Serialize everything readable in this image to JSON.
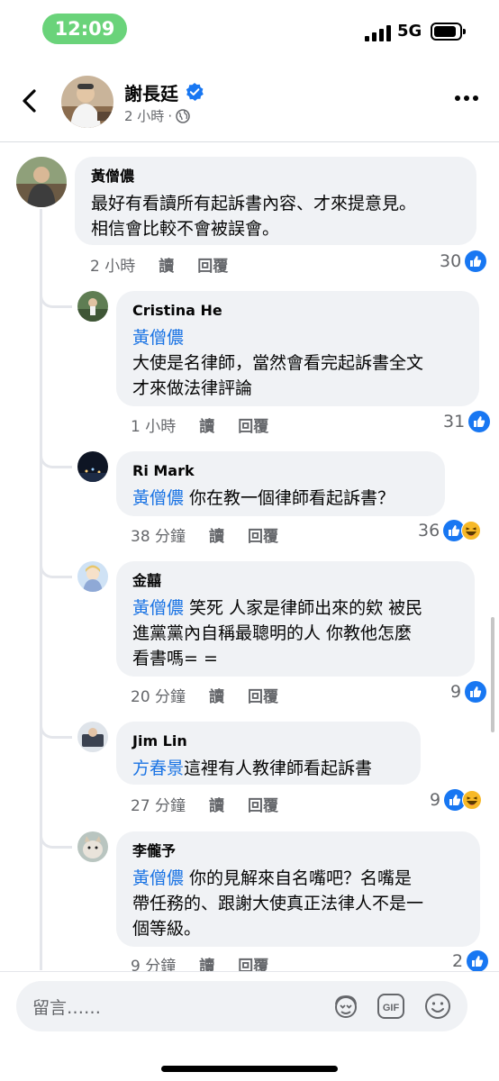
{
  "status_bar": {
    "time": "12:09",
    "network": "5G"
  },
  "header": {
    "page_name": "謝長廷",
    "post_time": "2 小時",
    "separator": "·"
  },
  "comments": [
    {
      "author": "黃僧儂",
      "mention": "",
      "text": "最好有看讀所有起訴書內容、才來提意見。\n相信會比較不會被誤會。",
      "time": "2 小時",
      "read_label": "讀",
      "reply_label": "回覆",
      "reaction_count": "30",
      "reactions": [
        "like-icon"
      ]
    },
    {
      "author": "Cristina He",
      "mention": "黃僧儂",
      "text": "大使是名律師，當然會看完起訴書全文\n才來做法律評論",
      "time": "1 小時",
      "read_label": "讀",
      "reply_label": "回覆",
      "reaction_count": "31",
      "reactions": [
        "like-icon"
      ]
    },
    {
      "author": "Ri Mark",
      "mention": "黃僧儂",
      "text": " 你在教一個律師看起訴書？",
      "time": "38 分鐘",
      "read_label": "讀",
      "reply_label": "回覆",
      "reaction_count": "36",
      "reactions": [
        "like-icon",
        "haha-icon"
      ]
    },
    {
      "author": "金囍",
      "mention": "黃僧儂",
      "text": " 笑死 人家是律師出來的欸 被民\n進黨黨內自稱最聰明的人 你教他怎麼\n看書嗎= =",
      "time": "20 分鐘",
      "read_label": "讀",
      "reply_label": "回覆",
      "reaction_count": "9",
      "reactions": [
        "like-icon"
      ]
    },
    {
      "author": "Jim Lin",
      "mention": "方春景",
      "text": "這裡有人教律師看起訴書",
      "time": "27 分鐘",
      "read_label": "讀",
      "reply_label": "回覆",
      "reaction_count": "9",
      "reactions": [
        "like-icon",
        "haha-icon"
      ]
    },
    {
      "author": "李儱予",
      "mention": "黃僧儂",
      "text": " 你的見解來自名嘴吧？名嘴是\n帶任務的、跟謝大使真正法律人不是一\n個等級。",
      "time": "9 分鐘",
      "read_label": "讀",
      "reply_label": "回覆",
      "reaction_count": "2",
      "reactions": [
        "like-icon"
      ]
    }
  ],
  "composer": {
    "placeholder": "留言……",
    "icons": [
      "avatar-sticker-icon",
      "gif-icon",
      "emoji-icon"
    ],
    "gif_label": "GIF"
  },
  "colors": {
    "mention": "#1b74e4",
    "like": "#1877f2",
    "bubble": "#f0f2f5",
    "time_pill": "#6ad37a"
  }
}
